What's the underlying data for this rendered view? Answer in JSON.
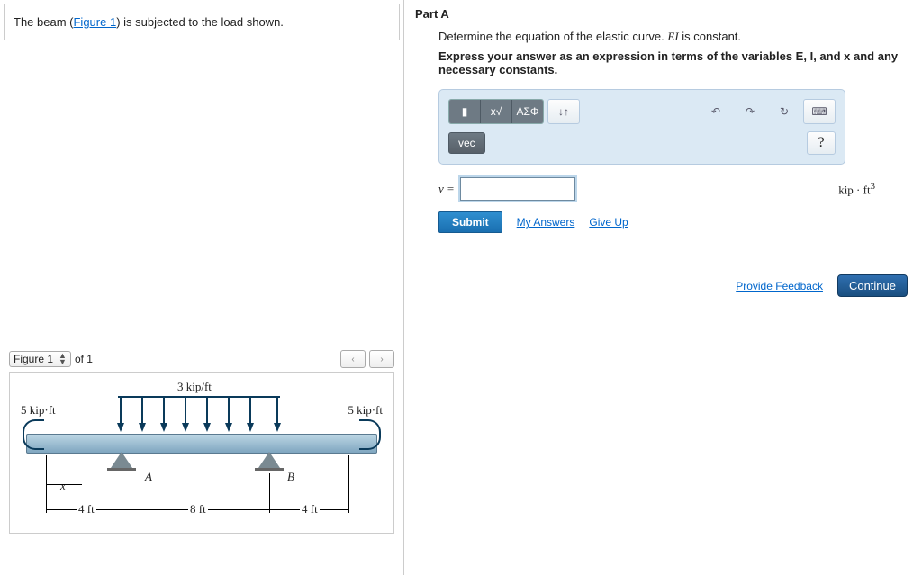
{
  "problem": {
    "text_a": "The beam (",
    "figlink": "Figure 1",
    "text_b": ") is subjected to the load shown."
  },
  "figure": {
    "selector_label": "Figure 1",
    "of_text": "of 1",
    "nav_prev": "‹",
    "nav_next": "›",
    "load_label": "3 kip/ft",
    "moment_left": "5 kip·ft",
    "moment_right": "5 kip·ft",
    "support_A": "A",
    "support_B": "B",
    "x_label": "x",
    "dim1": "4 ft",
    "dim2": "8 ft",
    "dim3": "4 ft"
  },
  "part": {
    "title": "Part A",
    "instruction_a": "Determine the equation of the elastic curve. ",
    "instruction_ei": "EI",
    "instruction_b": " is constant.",
    "instruction2_a": "Express your answer as an expression in terms of the variables ",
    "instruction2_E": "E",
    "instruction2_comma1": ", ",
    "instruction2_I": "I",
    "instruction2_comma2": ", and ",
    "instruction2_x": "x",
    "instruction2_tail": " and any necessary constants."
  },
  "toolbar": {
    "template": "▮",
    "frac": "x√",
    "greek": "ΑΣΦ",
    "subscript": "↓↑",
    "undo": "↶",
    "redo": "↷",
    "reset": "↻",
    "keyboard": "⌨",
    "vec": "vec",
    "help": "?"
  },
  "equation": {
    "var": "v =",
    "value": "",
    "units": "kip · ft³"
  },
  "actions": {
    "submit": "Submit",
    "my_answers": "My Answers",
    "give_up": "Give Up",
    "provide_feedback": "Provide Feedback",
    "continue": "Continue"
  }
}
